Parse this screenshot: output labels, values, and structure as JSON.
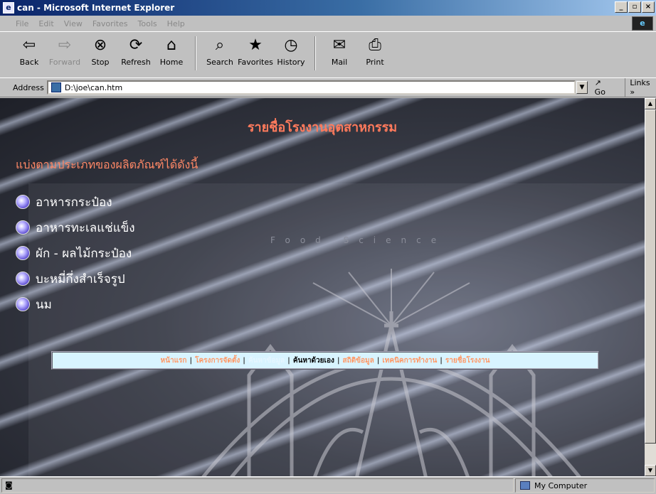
{
  "window": {
    "title": "can - Microsoft Internet Explorer",
    "minimize": "_",
    "maximize": "▫",
    "close": "×"
  },
  "menu": [
    "File",
    "Edit",
    "View",
    "Favorites",
    "Tools",
    "Help"
  ],
  "toolbar": [
    {
      "label": "Back",
      "icon": "back-arrow-icon",
      "glyph": "⇦"
    },
    {
      "label": "Forward",
      "icon": "forward-arrow-icon",
      "glyph": "⇨"
    },
    {
      "label": "Stop",
      "icon": "stop-icon",
      "glyph": "⊗"
    },
    {
      "label": "Refresh",
      "icon": "refresh-icon",
      "glyph": "⟳"
    },
    {
      "label": "Home",
      "icon": "home-icon",
      "glyph": "⌂"
    },
    {
      "label": "Search",
      "icon": "search-icon",
      "glyph": "⌕"
    },
    {
      "label": "Favorites",
      "icon": "favorites-icon",
      "glyph": "★"
    },
    {
      "label": "History",
      "icon": "history-icon",
      "glyph": "◷"
    },
    {
      "label": "Mail",
      "icon": "mail-icon",
      "glyph": "✉"
    },
    {
      "label": "Print",
      "icon": "print-icon",
      "glyph": "⎙"
    }
  ],
  "address": {
    "label": "Address",
    "value": "D:\\joe\\can.htm",
    "go": "Go",
    "links": "Links »"
  },
  "page": {
    "heading": "รายชื่อโรงงานอุตสาหกรรม",
    "subheading": "แบ่งตามประเภทของผลิตภัณฑ์ได้ดังนี้",
    "categories": [
      "อาหารกระป๋อง",
      "อาหารทะเลแช่แข็ง",
      "ผัก - ผลไม้กระป๋อง",
      "บะหมี่กึ่งสำเร็จรูป",
      "นม"
    ],
    "watermark_text": "Food Science",
    "nav_links": [
      "หน้าแรก",
      "โครงการจัดตั้ง",
      "ค้นหาข้อมูล",
      "ค้นหาด้วยเอง",
      "สถิติข้อมูล",
      "เทคนิคการทำงาน",
      "รายชื่อโรงงาน"
    ],
    "nav_separator": "|"
  },
  "status": {
    "text": "",
    "zone": "My Computer"
  },
  "colors": {
    "heading": "#ff7a5c",
    "nav_bg": "#d8f4ff",
    "nav_link": "#ff9966"
  }
}
